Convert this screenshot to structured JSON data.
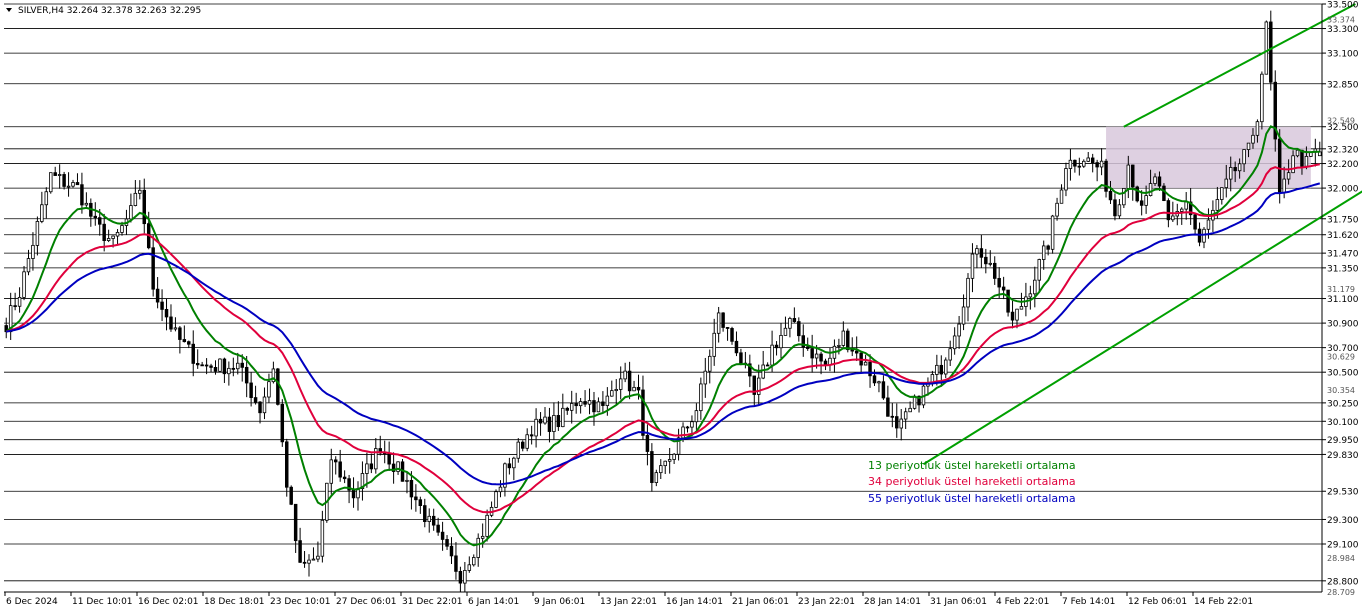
{
  "chart_data": {
    "type": "candlestick",
    "title": "SILVER,H4  32.264 32.378 32.263 32.295",
    "symbol": "SILVER",
    "timeframe": "H4",
    "ohlc_last": {
      "open": 32.264,
      "high": 32.378,
      "low": 32.263,
      "close": 32.295
    },
    "ylim": [
      28.709,
      33.5
    ],
    "y_ticks_major": [
      "33.500",
      "33.300",
      "33.100",
      "32.850",
      "32.500",
      "32.320",
      "32.200",
      "32.000",
      "31.750",
      "31.620",
      "31.470",
      "31.350",
      "31.100",
      "30.900",
      "30.700",
      "30.500",
      "30.250",
      "30.100",
      "29.950",
      "29.830",
      "29.530",
      "29.300",
      "29.100",
      "28.800"
    ],
    "y_ticks_minor": [
      "33.374",
      "32.549",
      "31.179",
      "30.629",
      "30.354",
      "28.984",
      "28.709"
    ],
    "x_ticks": [
      "6 Dec 2024",
      "11 Dec 10:01",
      "16 Dec 02:01",
      "18 Dec 18:01",
      "23 Dec 10:01",
      "27 Dec 06:01",
      "31 Dec 22:01",
      "6 Jan 14:01",
      "9 Jan 06:01",
      "13 Jan 22:01",
      "16 Jan 14:01",
      "21 Jan 06:01",
      "23 Jan 22:01",
      "28 Jan 14:01",
      "31 Jan 06:01",
      "4 Feb 22:01",
      "7 Feb 14:01",
      "12 Feb 06:01",
      "14 Feb 22:01"
    ],
    "price_path": [
      [
        0,
        30.9
      ],
      [
        3,
        31.15
      ],
      [
        10,
        32.1
      ],
      [
        16,
        32.0
      ],
      [
        20,
        31.7
      ],
      [
        24,
        31.55
      ],
      [
        28,
        31.8
      ],
      [
        30,
        32.0
      ],
      [
        33,
        31.2
      ],
      [
        38,
        30.8
      ],
      [
        44,
        30.55
      ],
      [
        52,
        30.55
      ],
      [
        57,
        30.2
      ],
      [
        60,
        30.55
      ],
      [
        63,
        29.6
      ],
      [
        66,
        28.9
      ],
      [
        70,
        29.0
      ],
      [
        73,
        29.8
      ],
      [
        78,
        29.5
      ],
      [
        84,
        29.9
      ],
      [
        90,
        29.6
      ],
      [
        96,
        29.2
      ],
      [
        102,
        28.85
      ],
      [
        107,
        29.2
      ],
      [
        112,
        29.7
      ],
      [
        118,
        30.05
      ],
      [
        124,
        30.1
      ],
      [
        129,
        30.3
      ],
      [
        134,
        30.2
      ],
      [
        138,
        30.5
      ],
      [
        142,
        30.3
      ],
      [
        145,
        29.55
      ],
      [
        149,
        29.8
      ],
      [
        155,
        30.2
      ],
      [
        160,
        30.95
      ],
      [
        164,
        30.7
      ],
      [
        168,
        30.3
      ],
      [
        172,
        30.7
      ],
      [
        176,
        30.9
      ],
      [
        180,
        30.7
      ],
      [
        184,
        30.55
      ],
      [
        188,
        30.8
      ],
      [
        192,
        30.6
      ],
      [
        196,
        30.4
      ],
      [
        200,
        30.0
      ],
      [
        205,
        30.3
      ],
      [
        210,
        30.55
      ],
      [
        214,
        30.95
      ],
      [
        218,
        31.55
      ],
      [
        222,
        31.3
      ],
      [
        226,
        30.9
      ],
      [
        230,
        31.2
      ],
      [
        234,
        31.55
      ],
      [
        238,
        32.2
      ],
      [
        242,
        32.25
      ],
      [
        246,
        32.15
      ],
      [
        249,
        31.8
      ],
      [
        252,
        32.2
      ],
      [
        255,
        31.8
      ],
      [
        258,
        32.1
      ],
      [
        261,
        31.7
      ],
      [
        265,
        31.9
      ],
      [
        268,
        31.55
      ],
      [
        271,
        31.8
      ],
      [
        275,
        32.1
      ],
      [
        279,
        32.3
      ],
      [
        281,
        32.6
      ],
      [
        283,
        33.3
      ],
      [
        286,
        31.9
      ],
      [
        289,
        32.3
      ],
      [
        292,
        32.2
      ],
      [
        294,
        32.3
      ]
    ],
    "annotations": {
      "consolidation_zone": {
        "y_top": 32.5,
        "y_bottom": 32.0,
        "x_start_index": 247,
        "x_end_index": 293
      },
      "upper_channel": {
        "from": [
          251,
          32.5
        ],
        "to": [
          303,
          33.5
        ]
      },
      "lower_channel": {
        "from": [
          206,
          29.75
        ],
        "to": [
          339,
          32.75
        ]
      }
    },
    "series": [
      {
        "name": "13 periyotluk üstel hareketli ortalama",
        "period": 13,
        "color": "#008000"
      },
      {
        "name": "34 periyotluk üstel hareketli ortalama",
        "period": 34,
        "color": "#e0003c"
      },
      {
        "name": "55 periyotluk üstel hareketli ortalama",
        "period": 55,
        "color": "#0000c0"
      }
    ],
    "colors": {
      "candle": "#000000",
      "grid": "#000000",
      "zone": "#d8c8dc",
      "channel": "#00a000"
    }
  }
}
